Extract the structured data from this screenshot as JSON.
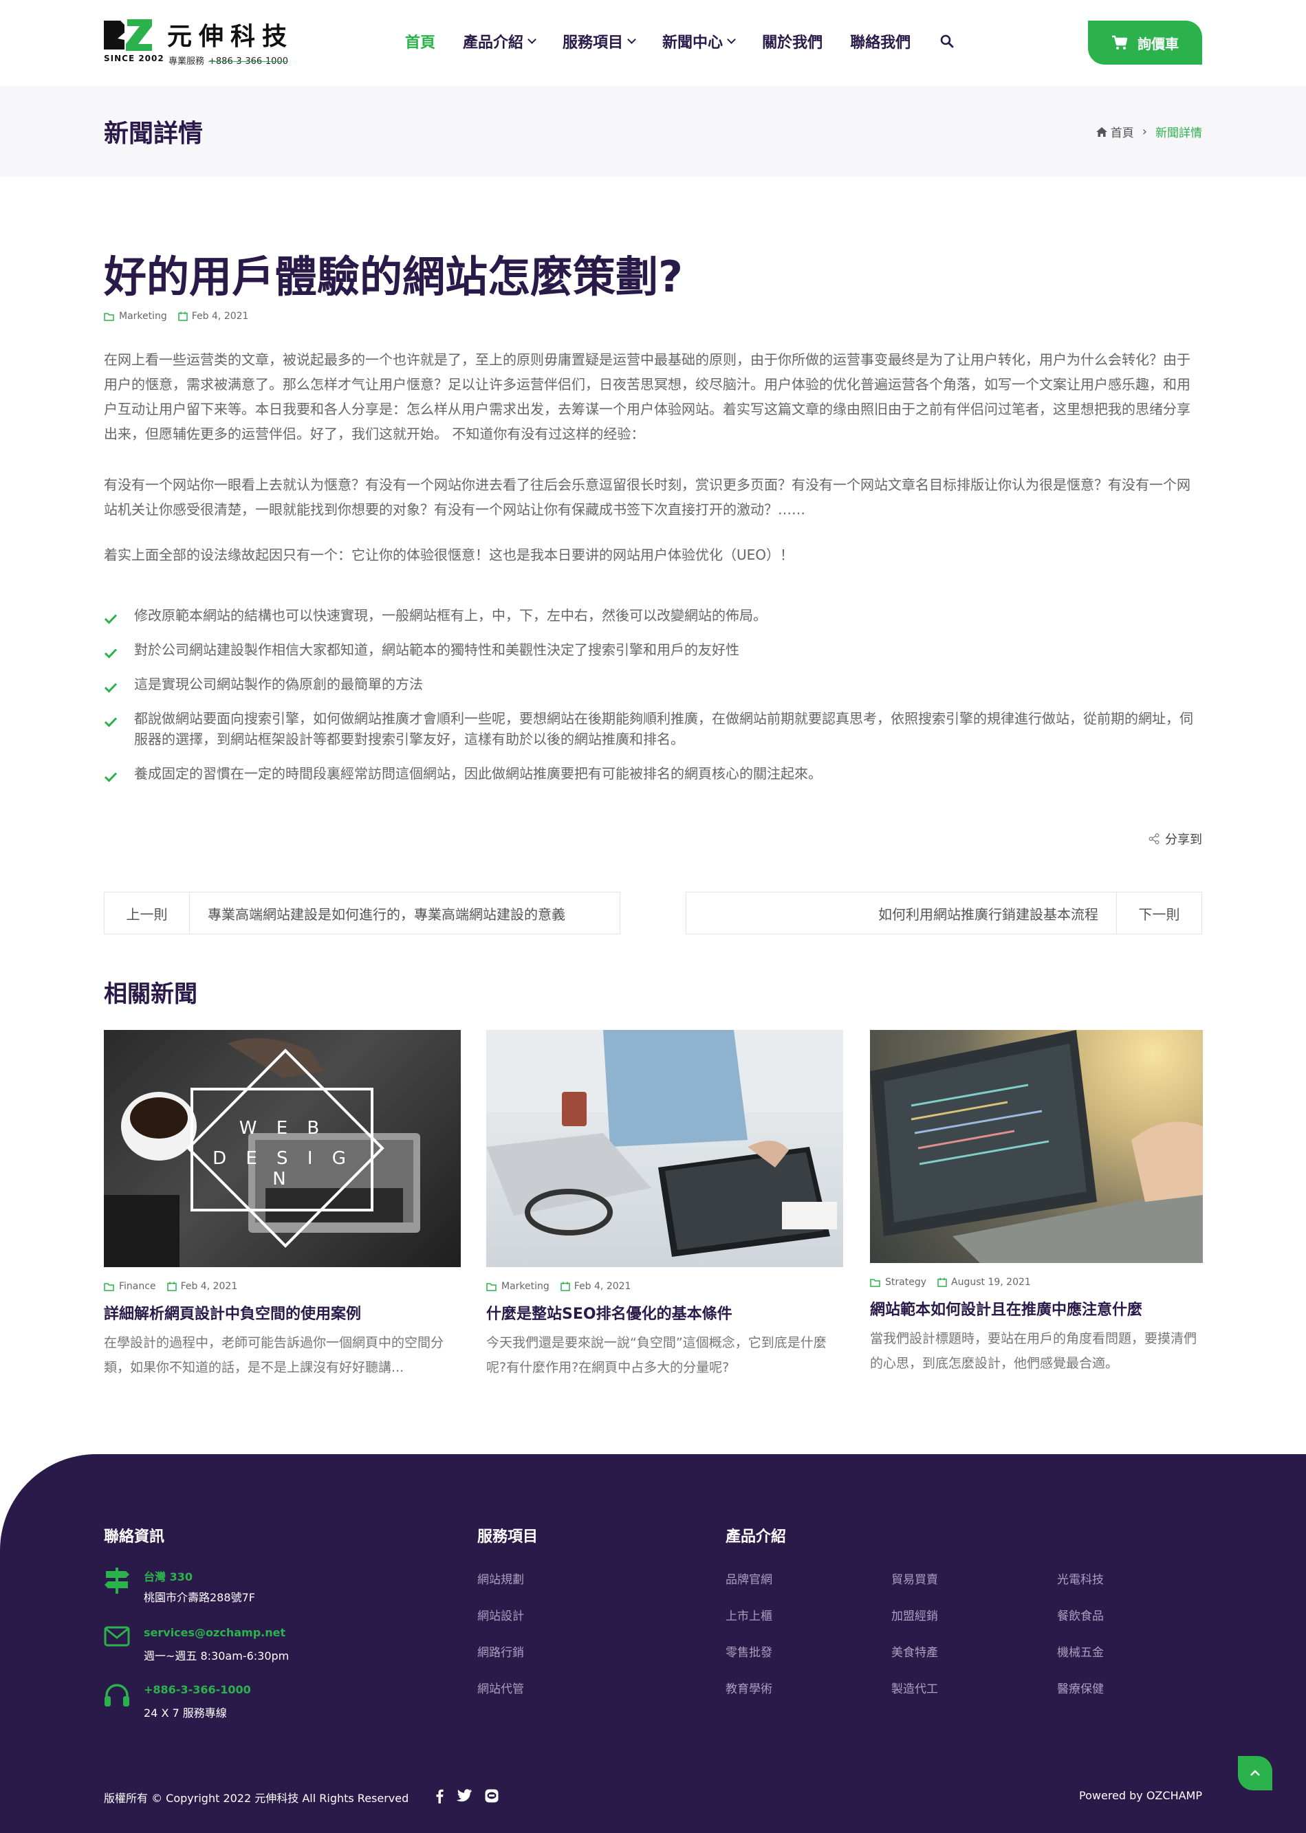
{
  "brand": {
    "name": "元伸科技",
    "since": "SINCE 2002",
    "service_label": "專業服務",
    "phone": "+886-3-366-1000"
  },
  "nav": {
    "items": [
      {
        "label": "首頁",
        "active": true
      },
      {
        "label": "產品介紹",
        "dropdown": true
      },
      {
        "label": "服務項目",
        "dropdown": true
      },
      {
        "label": "新聞中心",
        "dropdown": true
      },
      {
        "label": "關於我們"
      },
      {
        "label": "聯絡我們"
      }
    ],
    "search_icon": "search-icon",
    "cart_label": "詢價車"
  },
  "titlebar": {
    "title": "新聞詳情",
    "breadcrumb_home": "首頁",
    "breadcrumb_sep": "›",
    "breadcrumb_current": "新聞詳情"
  },
  "article": {
    "title": "好的用戶體驗的網站怎麼策劃?",
    "category": "Marketing",
    "date": "Feb 4, 2021",
    "paragraphs": [
      "在网上看一些运营类的文章，被说起最多的一个也许就是了，至上的原则毋庸置疑是运营中最基础的原则，由于你所做的运营事变最终是为了让用户转化，用户为什么会转化？由于用户的惬意，需求被满意了。那么怎样才气让用户惬意？足以让许多运营伴侣们，日夜苦思冥想，绞尽脑汁。用户体验的优化普遍运营各个角落，如写一个文案让用户感乐趣，和用户互动让用户留下来等。本日我要和各人分享是：怎么样从用户需求出发，去筹谋一个用户体验网站。着实写这篇文章的缘由照旧由于之前有伴侣问过笔者，这里想把我的思绪分享出来，但愿辅佐更多的运营伴侣。好了，我们这就开始。 不知道你有没有过这样的经验：",
      "有没有一个网站你一眼看上去就认为惬意？有没有一个网站你进去看了往后会乐意逗留很长时刻，赏识更多页面？有没有一个网站文章名目标排版让你认为很是惬意？有没有一个网站机关让你感受很清楚，一眼就能找到你想要的对象？有没有一个网站让你有保藏成书签下次直接打开的激动？……",
      "着实上面全部的设法缘故起因只有一个：它让你的体验很惬意！这也是我本日要讲的网站用户体验优化（UEO）！"
    ],
    "checklist": [
      "修改原範本網站的結構也可以快速實現，一般網站框有上，中，下，左中右，然後可以改變網站的佈局。",
      "對於公司網站建設製作相信大家都知道，網站範本的獨特性和美觀性決定了搜索引擎和用戶的友好性",
      "這是實現公司網站製作的偽原創的最簡單的方法",
      "都說做網站要面向搜索引擎，如何做網站推廣才會順利一些呢，要想網站在後期能夠順利推廣，在做網站前期就要認真思考，依照搜索引擎的規律進行做站，從前期的網址，伺服器的選擇，到網站框架設計等都要對搜索引擎友好，這樣有助於以後的網站推廣和排名。",
      "養成固定的習慣在一定的時間段裏經常訪問這個網站，因此做網站推廣要把有可能被排名的網頁核心的關注起來。"
    ],
    "share_label": "分享到"
  },
  "post_nav": {
    "prev_label": "上一則",
    "prev_title": "專業高端網站建設是如何進行的，專業高端網站建設的意義",
    "next_label": "下一則",
    "next_title": "如何利用網站推廣行銷建設基本流程"
  },
  "related": {
    "heading": "相關新聞",
    "cards": [
      {
        "category": "Finance",
        "date": "Feb 4, 2021",
        "title": "詳細解析網頁設計中負空間的使用案例",
        "excerpt": "在學設計的過程中，老師可能告訴過你一個網頁中的空間分類，如果你不知道的話，是不是上課沒有好好聽講...",
        "image_text_1": "W E B",
        "image_text_2": "D E S I G N"
      },
      {
        "category": "Marketing",
        "date": "Feb 4, 2021",
        "title": "什麼是整站SEO排名優化的基本條件",
        "excerpt": "今天我們還是要來說一說“負空間”這個概念，它到底是什麼呢?有什麼作用?在網頁中占多大的分量呢?"
      },
      {
        "category": "Strategy",
        "date": "August 19, 2021",
        "title": "網站範本如何設計且在推廣中應注意什麼",
        "excerpt": "當我們設計標題時，要站在用戶的角度看問題，要摸清們的心思，到底怎麼設計，他們感覺最合適。"
      }
    ]
  },
  "footer": {
    "contact_title": "聯絡資訊",
    "contact": [
      {
        "icon": "signpost-icon",
        "line1": "台灣 330",
        "line2": "桃園市介壽路288號7F"
      },
      {
        "icon": "mail-icon",
        "line1": "services@ozchamp.net",
        "line2": "週一~週五 8:30am-6:30pm"
      },
      {
        "icon": "headset-icon",
        "line1": "+886-3-366-1000",
        "line2": "24 X 7 服務專線"
      }
    ],
    "services_title": "服務項目",
    "services": [
      "網站規劃",
      "網站設計",
      "網路行銷",
      "網站代管"
    ],
    "products_title": "產品介紹",
    "products_col1": [
      "品牌官網",
      "上市上櫃",
      "零售批發",
      "教育學術"
    ],
    "products_col2": [
      "貿易買賣",
      "加盟經銷",
      "美食特產",
      "製造代工"
    ],
    "products_col3": [
      "光電科技",
      "餐飲食品",
      "機械五金",
      "醫療保健"
    ],
    "copyright": "版權所有 © Copyright 2022 元伸科技 All Rights Reserved",
    "social": [
      "facebook-icon",
      "twitter-icon",
      "line-icon"
    ],
    "powered": "Powered by OZCHAMP"
  },
  "colors": {
    "accent": "#2bb24c",
    "dark": "#2a1a4a",
    "text": "#666666"
  }
}
